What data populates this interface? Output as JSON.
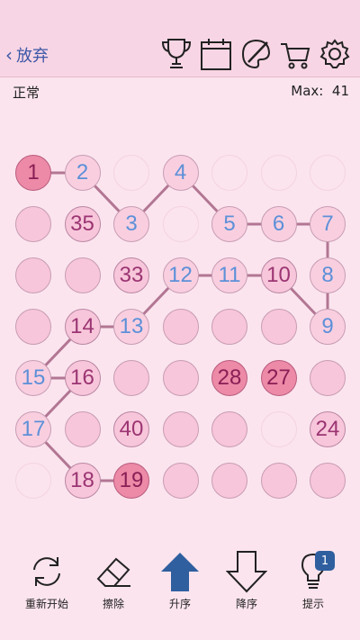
{
  "header": {
    "back_label": "放弃",
    "icons": [
      "trophy-icon",
      "calendar-icon",
      "palette-icon",
      "cart-icon",
      "gear-icon"
    ]
  },
  "status": {
    "mode": "正常",
    "max_label": "Max:",
    "max_value": "41"
  },
  "board": {
    "cols": 7,
    "rows": 7,
    "cells": [
      {
        "n": "1",
        "s": "hot"
      },
      {
        "n": "2",
        "s": "blue"
      },
      {
        "n": "",
        "s": "hidden"
      },
      {
        "n": "4",
        "s": "blue"
      },
      {
        "n": "",
        "s": "hidden"
      },
      {
        "n": "",
        "s": "hidden"
      },
      {
        "n": "",
        "s": "hidden"
      },
      {
        "n": "",
        "s": "empty"
      },
      {
        "n": "35",
        "s": "purple"
      },
      {
        "n": "3",
        "s": "blue"
      },
      {
        "n": "",
        "s": "hidden"
      },
      {
        "n": "5",
        "s": "blue"
      },
      {
        "n": "6",
        "s": "blue"
      },
      {
        "n": "7",
        "s": "blue"
      },
      {
        "n": "",
        "s": "empty"
      },
      {
        "n": "",
        "s": "empty"
      },
      {
        "n": "33",
        "s": "purple"
      },
      {
        "n": "12",
        "s": "blue"
      },
      {
        "n": "11",
        "s": "blue"
      },
      {
        "n": "10",
        "s": "purple"
      },
      {
        "n": "8",
        "s": "blue"
      },
      {
        "n": "",
        "s": "empty"
      },
      {
        "n": "14",
        "s": "purple"
      },
      {
        "n": "13",
        "s": "blue"
      },
      {
        "n": "",
        "s": "empty"
      },
      {
        "n": "",
        "s": "empty"
      },
      {
        "n": "",
        "s": "empty"
      },
      {
        "n": "9",
        "s": "blue"
      },
      {
        "n": "15",
        "s": "blue"
      },
      {
        "n": "16",
        "s": "purple"
      },
      {
        "n": "",
        "s": "empty"
      },
      {
        "n": "",
        "s": "empty"
      },
      {
        "n": "28",
        "s": "hot"
      },
      {
        "n": "27",
        "s": "hot"
      },
      {
        "n": "",
        "s": "empty"
      },
      {
        "n": "17",
        "s": "blue"
      },
      {
        "n": "",
        "s": "empty"
      },
      {
        "n": "40",
        "s": "purple"
      },
      {
        "n": "",
        "s": "empty"
      },
      {
        "n": "",
        "s": "empty"
      },
      {
        "n": "",
        "s": "hidden"
      },
      {
        "n": "24",
        "s": "purple"
      },
      {
        "n": "",
        "s": "hidden"
      },
      {
        "n": "18",
        "s": "purple"
      },
      {
        "n": "19",
        "s": "hot"
      },
      {
        "n": "",
        "s": "empty"
      },
      {
        "n": "",
        "s": "empty"
      },
      {
        "n": "",
        "s": "empty"
      },
      {
        "n": "",
        "s": "empty"
      }
    ],
    "path": [
      "1",
      "2",
      "3",
      "4",
      "5",
      "6",
      "7",
      "8",
      "9",
      "10",
      "11",
      "12",
      "13",
      "14",
      "15",
      "16",
      "17",
      "18",
      "19"
    ]
  },
  "toolbar": {
    "items": [
      {
        "label": "重新开始",
        "icon": "restart-icon"
      },
      {
        "label": "擦除",
        "icon": "eraser-icon"
      },
      {
        "label": "升序",
        "icon": "arrow-up-icon"
      },
      {
        "label": "降序",
        "icon": "arrow-down-icon"
      },
      {
        "label": "提示",
        "icon": "hint-bulb-icon",
        "badge": "1"
      }
    ]
  },
  "colors": {
    "accent": "#2f5f9f",
    "hot": "#ec8aa7",
    "number_blue": "#5d90d8",
    "number_purple": "#9b3573",
    "line": "#b27693"
  }
}
